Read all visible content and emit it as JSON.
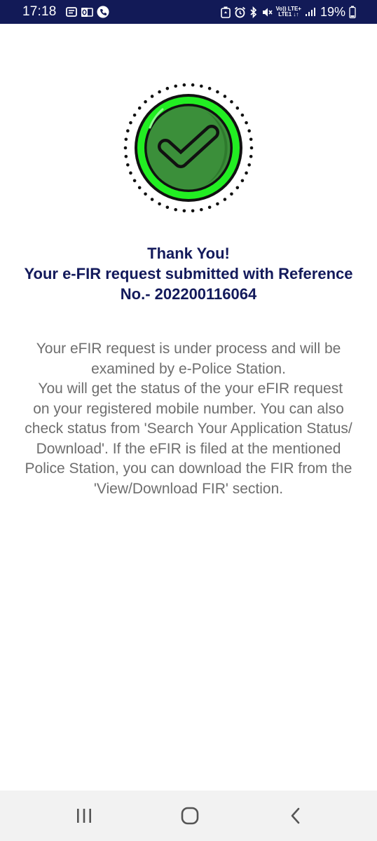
{
  "status_bar": {
    "time": "17:18",
    "network_label_top": "Vo)) LTE+",
    "network_label_bottom": "LTE1 ↓↑",
    "battery": "19%",
    "icons": [
      "message-icon",
      "outlook-icon",
      "phone-call-icon",
      "recycle-icon",
      "alarm-icon",
      "bluetooth-icon",
      "mute-icon",
      "signal-icon",
      "battery-icon"
    ]
  },
  "success": {
    "icon": "check-circle-icon",
    "colors": {
      "ring": "#22ee22",
      "inner": "#3b8f3a",
      "outline": "#111111",
      "dots": "#111111"
    }
  },
  "heading": {
    "line1": "Thank You!",
    "line2": "Your e-FIR request submitted with Reference",
    "line3": "No.- 202200116064",
    "color": "#131a5b"
  },
  "message": {
    "lines": [
      "Your eFIR request is under process and will be",
      "examined by e-Police Station.",
      " You will get the status of the your eFIR request",
      "on your registered mobile number. You can also",
      "check status from 'Search Your Application Status/",
      "Download'. If the eFIR is filed at the mentioned",
      "Police Station, you can download the FIR from the",
      "'View/Download FIR' section."
    ],
    "color": "#6e6e6e"
  },
  "nav_bar": {
    "buttons": [
      "recent-apps-icon",
      "home-icon",
      "back-icon"
    ]
  }
}
